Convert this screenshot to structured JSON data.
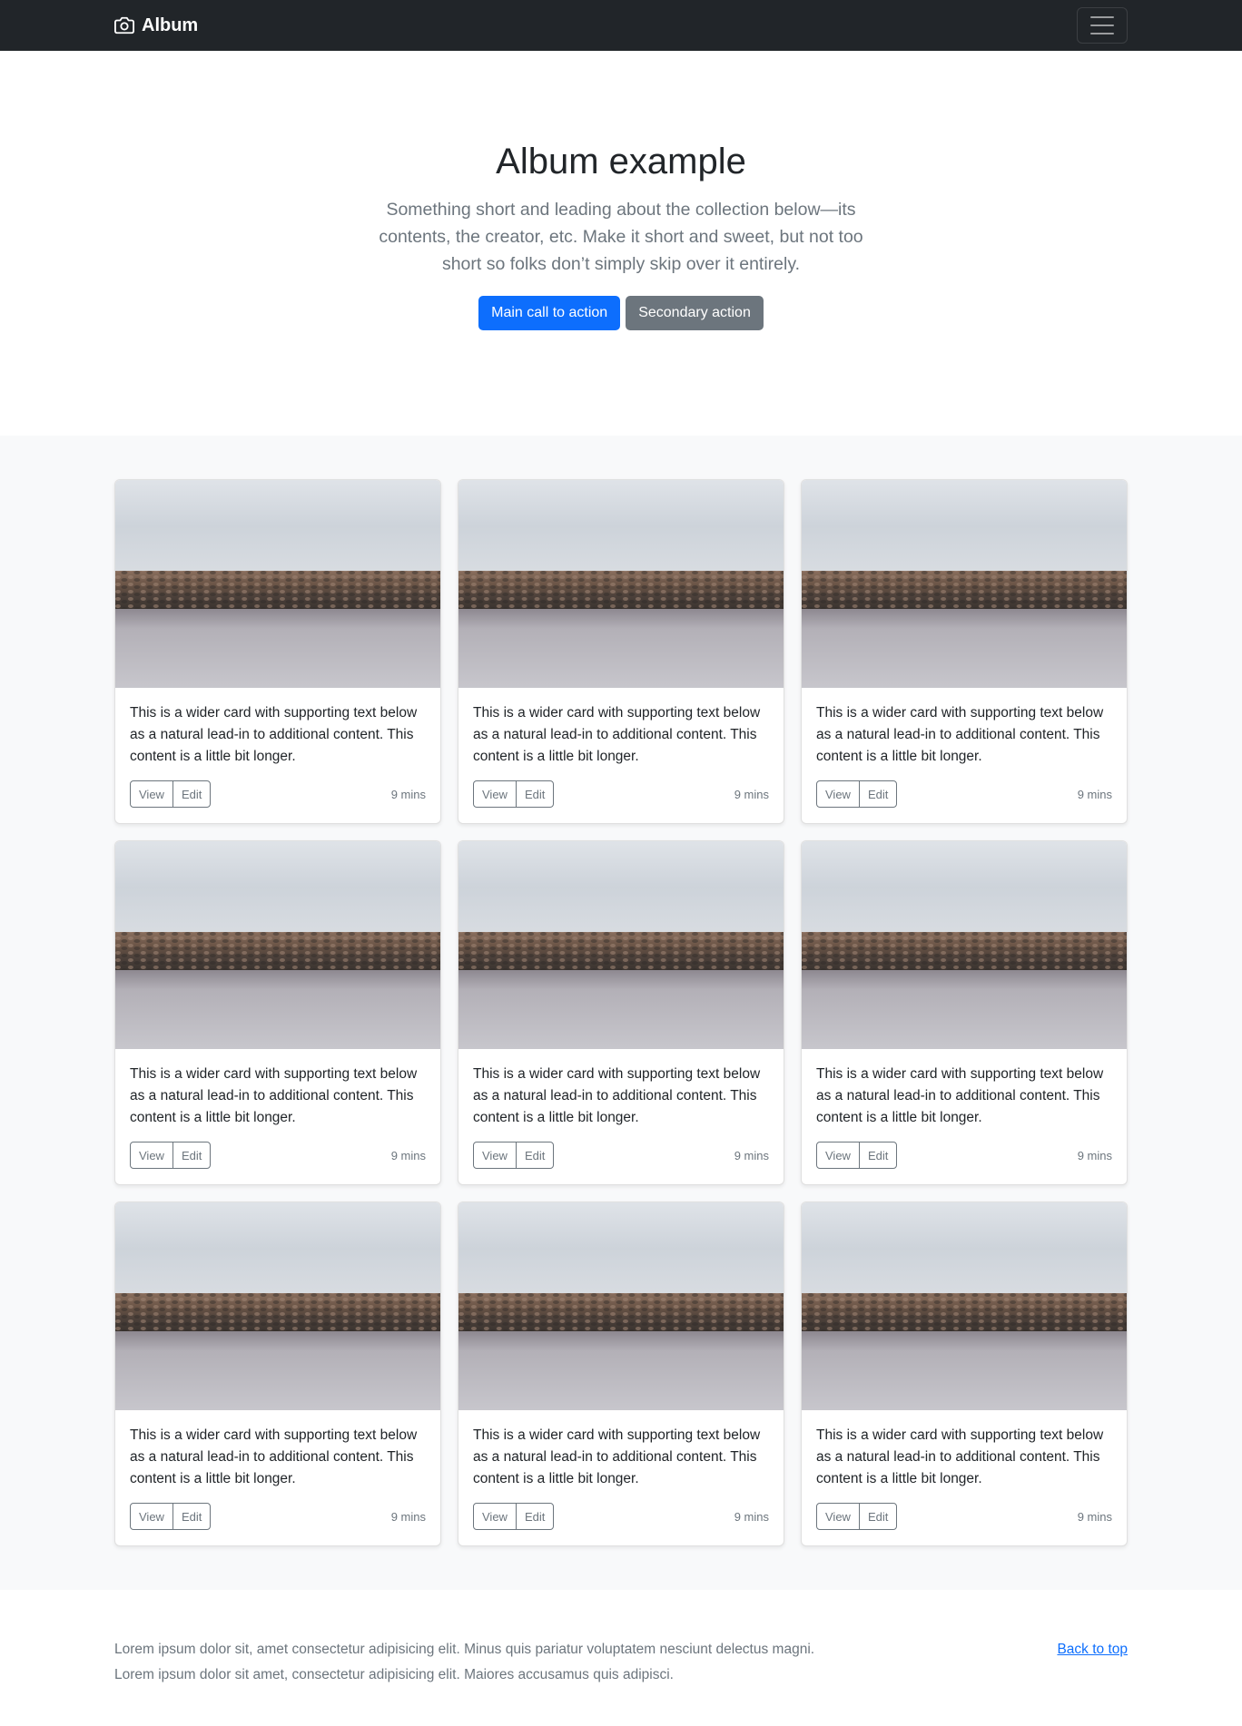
{
  "navbar": {
    "brand": "Album",
    "brand_icon": "camera-icon",
    "toggler_icon": "hamburger-icon"
  },
  "hero": {
    "title": "Album example",
    "lead": "Something short and leading about the collection below—its contents, the creator, etc. Make it short and sweet, but not too short so folks don’t simply skip over it entirely.",
    "primary_label": "Main call to action",
    "secondary_label": "Secondary action"
  },
  "cards": [
    {
      "text": "This is a wider card with supporting text below as a natural lead-in to additional content. This content is a little bit longer.",
      "view": "View",
      "edit": "Edit",
      "time": "9 mins"
    },
    {
      "text": "This is a wider card with supporting text below as a natural lead-in to additional content. This content is a little bit longer.",
      "view": "View",
      "edit": "Edit",
      "time": "9 mins"
    },
    {
      "text": "This is a wider card with supporting text below as a natural lead-in to additional content. This content is a little bit longer.",
      "view": "View",
      "edit": "Edit",
      "time": "9 mins"
    },
    {
      "text": "This is a wider card with supporting text below as a natural lead-in to additional content. This content is a little bit longer.",
      "view": "View",
      "edit": "Edit",
      "time": "9 mins"
    },
    {
      "text": "This is a wider card with supporting text below as a natural lead-in to additional content. This content is a little bit longer.",
      "view": "View",
      "edit": "Edit",
      "time": "9 mins"
    },
    {
      "text": "This is a wider card with supporting text below as a natural lead-in to additional content. This content is a little bit longer.",
      "view": "View",
      "edit": "Edit",
      "time": "9 mins"
    },
    {
      "text": "This is a wider card with supporting text below as a natural lead-in to additional content. This content is a little bit longer.",
      "view": "View",
      "edit": "Edit",
      "time": "9 mins"
    },
    {
      "text": "This is a wider card with supporting text below as a natural lead-in to additional content. This content is a little bit longer.",
      "view": "View",
      "edit": "Edit",
      "time": "9 mins"
    },
    {
      "text": "This is a wider card with supporting text below as a natural lead-in to additional content. This content is a little bit longer.",
      "view": "View",
      "edit": "Edit",
      "time": "9 mins"
    }
  ],
  "footer": {
    "line1": "Lorem ipsum dolor sit, amet consectetur adipisicing elit. Minus quis pariatur voluptatem nesciunt delectus magni.",
    "line2": "Lorem ipsum dolor sit amet, consectetur adipisicing elit. Maiores accusamus quis adipisci.",
    "back_to_top": "Back to top"
  },
  "colors": {
    "navbar_bg": "#212529",
    "primary": "#0d6efd",
    "secondary": "#6c757d",
    "album_bg": "#f8f9fa"
  }
}
